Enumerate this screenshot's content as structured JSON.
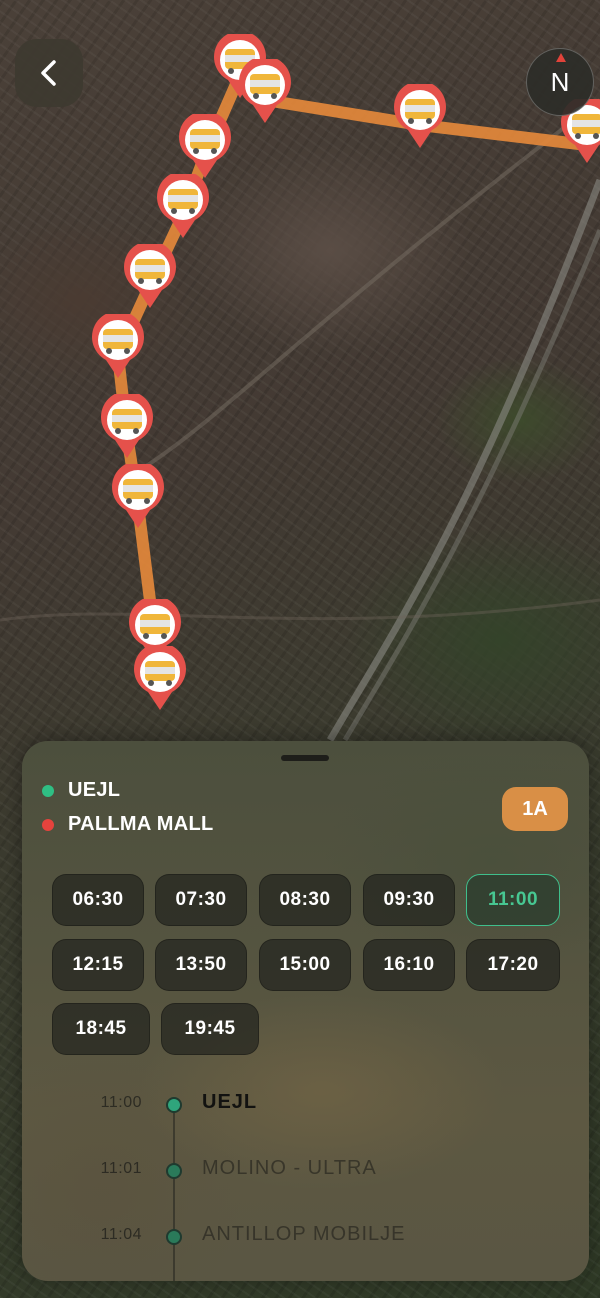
{
  "map": {
    "back_icon": "chevron-left-icon",
    "compass_label": "N",
    "attribution_icon": "apple-logo-icon",
    "route_color": "#e7893b",
    "pin_color": "#e5514b",
    "bus_color": "#f0b63a"
  },
  "sheet": {
    "origin": {
      "name": "UEJL",
      "color": "#2fbf84"
    },
    "destination": {
      "name": "PALLMA MALL",
      "color": "#e5433d"
    },
    "route_badge": "1A",
    "route_badge_color": "#d98f46",
    "departure_times": [
      "06:30",
      "07:30",
      "08:30",
      "09:30",
      "11:00",
      "12:15",
      "13:50",
      "15:00",
      "16:10",
      "17:20",
      "18:45",
      "19:45"
    ],
    "selected_time": "11:00",
    "timeline": [
      {
        "time": "11:00",
        "stop": "UEJL",
        "current": true
      },
      {
        "time": "11:01",
        "stop": "MOLINO - ULTRA",
        "current": false
      },
      {
        "time": "11:04",
        "stop": "ANTILLOP MOBILJE",
        "current": false
      }
    ]
  }
}
